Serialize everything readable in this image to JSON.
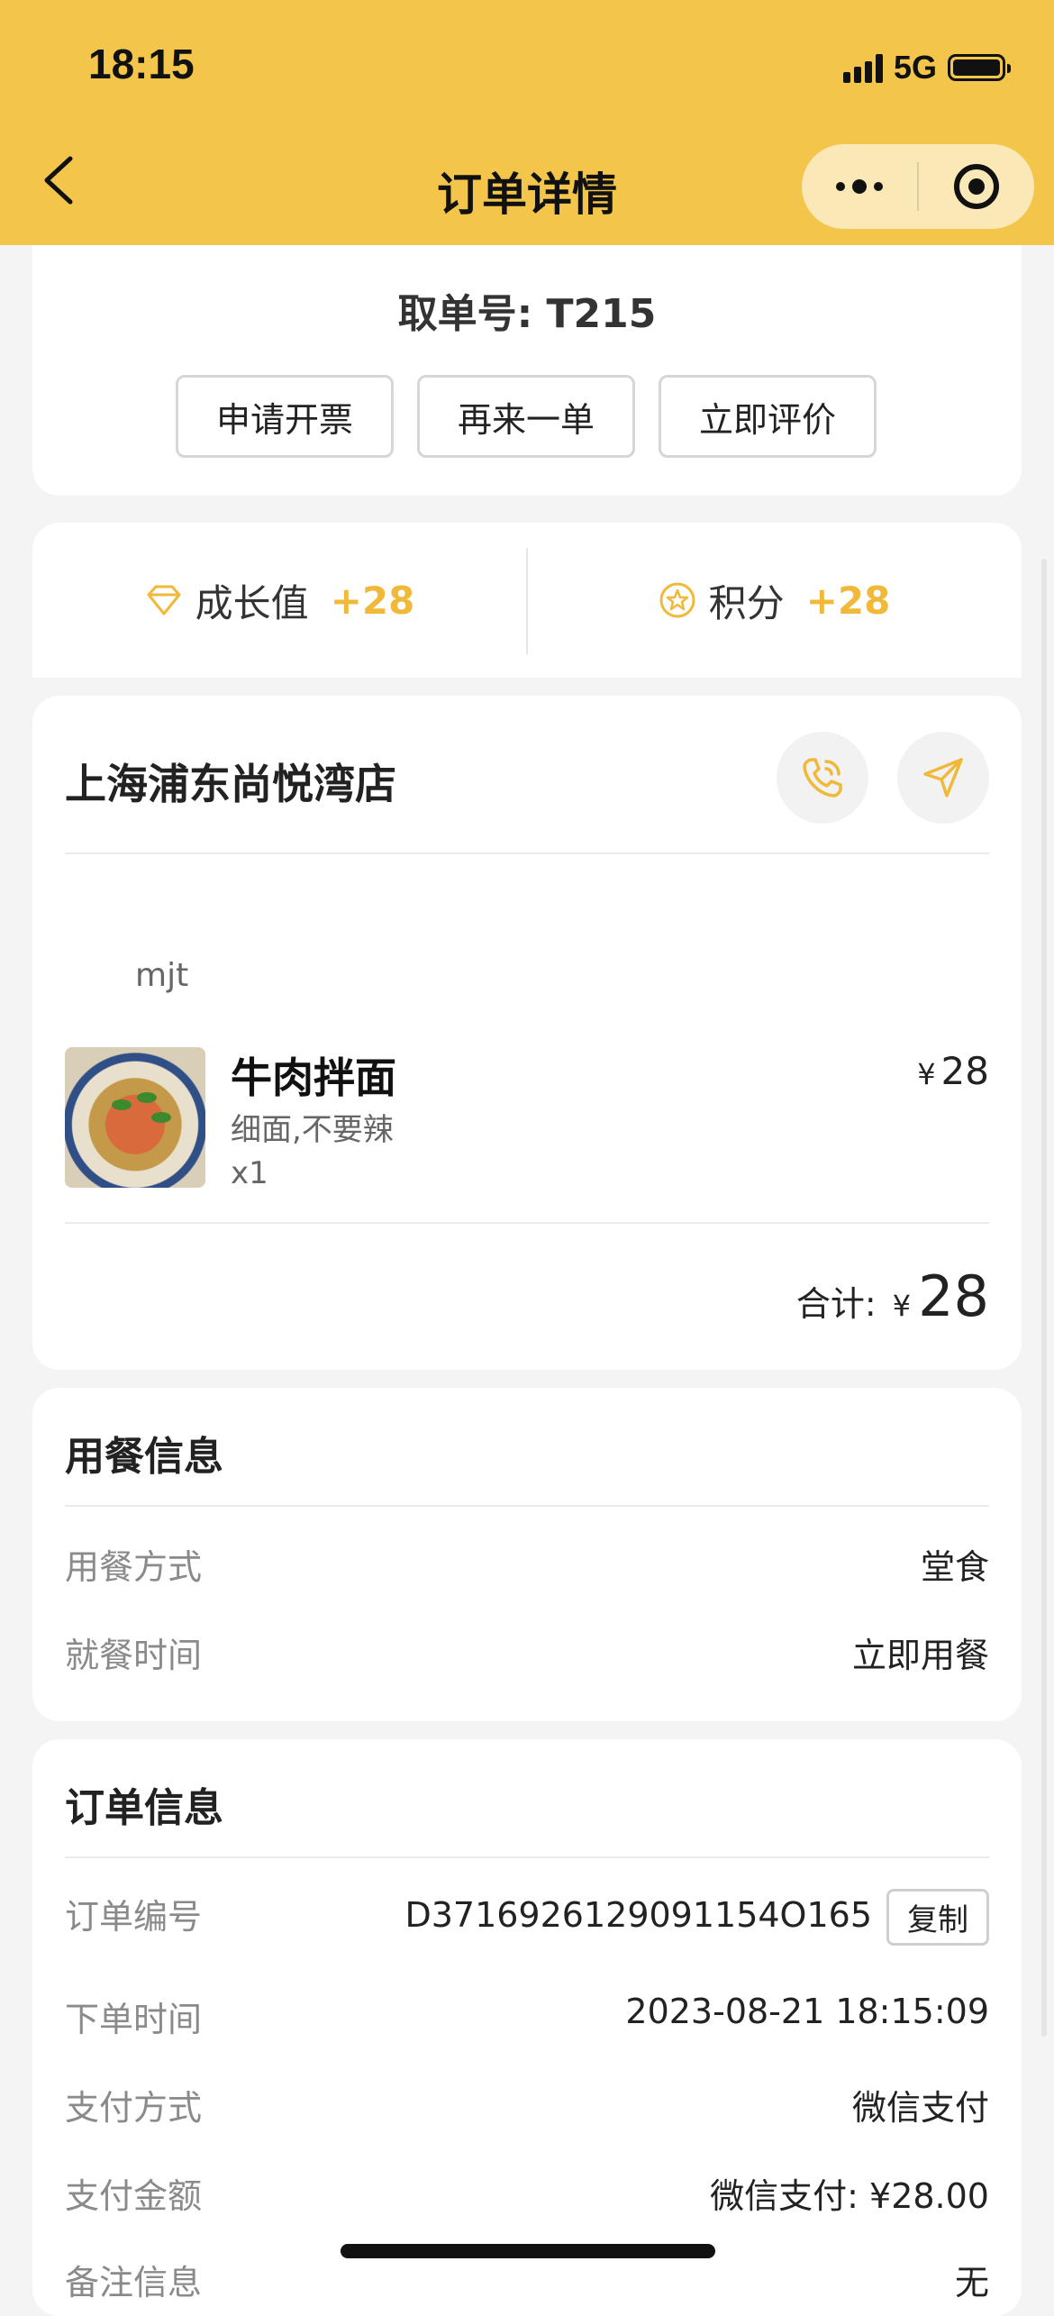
{
  "status_bar": {
    "time": "18:15",
    "network": "5G"
  },
  "nav": {
    "title": "订单详情"
  },
  "pickup": {
    "label": "取单号: T215",
    "actions": [
      "申请开票",
      "再来一单",
      "立即评价"
    ]
  },
  "points": {
    "growth_label": "成长值",
    "growth_value": "+28",
    "score_label": "积分",
    "score_value": "+28"
  },
  "store": {
    "name": "上海浦东尚悦湾店",
    "maker": "mjt",
    "item": {
      "name": "牛肉拌面",
      "spec": "细面,不要辣",
      "qty": "x1",
      "currency": "¥",
      "price": "28"
    },
    "total_label": "合计:",
    "total_currency": "¥",
    "total_amount": "28"
  },
  "dining": {
    "title": "用餐信息",
    "rows": [
      {
        "label": "用餐方式",
        "value": "堂食"
      },
      {
        "label": "就餐时间",
        "value": "立即用餐"
      }
    ]
  },
  "order": {
    "title": "订单信息",
    "copy_label": "复制",
    "rows": [
      {
        "label": "订单编号",
        "value": "D3716926129091154O165"
      },
      {
        "label": "下单时间",
        "value": "2023-08-21 18:15:09"
      },
      {
        "label": "支付方式",
        "value": "微信支付"
      },
      {
        "label": "支付金额",
        "value": "微信支付: ¥28.00"
      },
      {
        "label": "备注信息",
        "value": "无"
      }
    ]
  },
  "colors": {
    "brand": "#f3c54b",
    "accent": "#f0b93a"
  },
  "icons": [
    "back-arrow-icon",
    "more-icon",
    "close-target-icon",
    "diamond-icon",
    "star-coin-icon",
    "phone-icon",
    "navigate-icon"
  ]
}
